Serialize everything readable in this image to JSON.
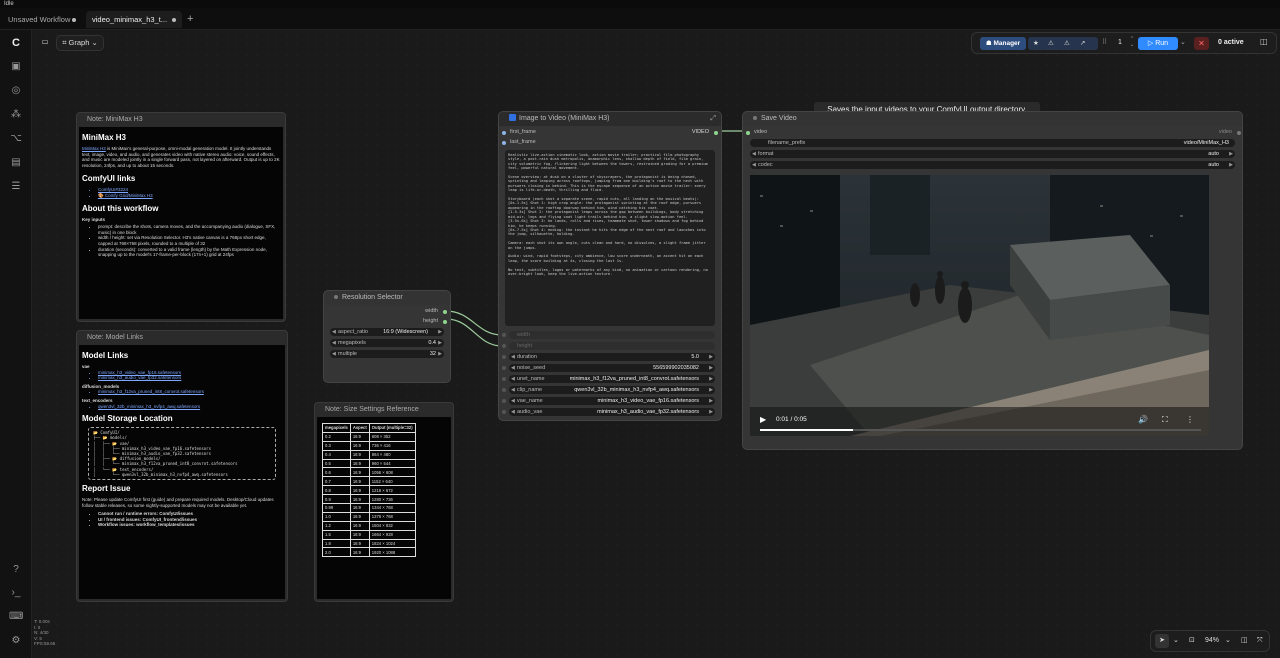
{
  "app": {
    "status": "Idle"
  },
  "tabs": [
    {
      "label": "Unsaved Workflow"
    },
    {
      "label": "video_minimax_h3_t..."
    }
  ],
  "tab_add": "+",
  "toolbar": {
    "graph_label": "Graph",
    "manager": "Manager",
    "run": "Run",
    "queue_count": "1",
    "active": "0 active"
  },
  "tooltip": "Saves the input videos to your ComfyUI output directory.",
  "stats": [
    "T: 0.00s",
    "I: 0",
    "N: 4/30",
    "V: 5",
    "FPS:59.65"
  ],
  "zoom": "94%",
  "note1": {
    "title": "Note: MiniMax H3",
    "heading": "MiniMax H3",
    "intro_link": "MiniMax H3",
    "intro": " is MiniMax's general-purpose, omni-modal generation model. It jointly understands text, image, video, and audio, and generates video with native stereo audio: voice, sound effects, and music are modeled jointly in a single forward pass, not layered on afterward. Output is up to 2K resolution, 24fps, and up to about 15 seconds.",
    "links_heading": "ComfyUI links",
    "links": [
      "ComfyUI#3224",
      "🎨 Comfy Grid/MiniMax H3"
    ],
    "about_heading": "About this workflow",
    "key_inputs": "Key inputs",
    "bullets": [
      "prompt: describe the shots, camera moves, and the accompanying audio (dialogue, SFX, music) in one block",
      "width / height: set via Resolution Selector. H3's native canvas is a 768px short edge, capped at 768×768 pixels, rounded to a multiple of 32",
      "duration (seconds): converted to a valid frame (length) by the Math Expression node, snapping up to the model's 17-frame-per-block (17n+1) grid at 24fps"
    ]
  },
  "note2": {
    "title": "Note: Model Links",
    "heading": "Model Links",
    "vae_label": "vae",
    "vae": [
      "minimax_h3_video_vae_fp16.safetensors",
      "minimax_h3_audio_vae_fp32.safetensors"
    ],
    "dm_label": "diffusion_models",
    "dm": [
      "minimax_h3_f12va_pruned_int8_convrot.safetensors"
    ],
    "te_label": "text_encoders",
    "te": [
      "qwen3vl_32b_minimax_h3_nvfp4_awq.safetensors"
    ],
    "storage_heading": "Model Storage Location",
    "tree": [
      "📂 ComfyUI/",
      "├── 📂 models/",
      "│   ├── 📂 vae/",
      "│   │   ├── minimax_h3_video_vae_fp16.safetensors",
      "│   │   └── minimax_h3_audio_vae_fp32.safetensors",
      "│   ├── 📂 diffusion_models/",
      "│   │   └── minimax_h3_f12va_pruned_int8_convrot.safetensors",
      "│   └── 📂 text_encoders/",
      "│       └── qwen3vl_32b_minimax_h3_nvfp4_awq.safetensors"
    ],
    "report_heading": "Report Issue",
    "report_text": "Note: Please update ComfyUI first (guide) and prepare required models. Desktop/Cloud updates follow stable releases, so some nightly-supported models may not be available yet.",
    "report_items": [
      "Cannot run / runtime errors: ComfyUI/issues",
      "UI / frontend issues: ComfyUI_frontend/issues",
      "Workflow issues: workflow_templates/issues"
    ]
  },
  "res": {
    "title": "Resolution Selector",
    "out_width": "width",
    "out_height": "height",
    "widgets": [
      {
        "l": "aspect_ratio",
        "v": "16:9 (Widescreen)"
      },
      {
        "l": "megapixels",
        "v": "0.4"
      },
      {
        "l": "multiple",
        "v": "32"
      }
    ]
  },
  "sizes": {
    "title": "Note: Size Settings Reference",
    "headers": [
      "megapixels",
      "Aspect",
      "Output (multiple=32)"
    ],
    "rows": [
      [
        "0.2",
        "16:9",
        "608 × 352"
      ],
      [
        "0.3",
        "16:9",
        "736 × 416"
      ],
      [
        "0.4",
        "16:9",
        "864 × 480"
      ],
      [
        "0.5",
        "16:9",
        "960 × 544"
      ],
      [
        "0.6",
        "16:9",
        "1056 × 608"
      ],
      [
        "0.7",
        "16:9",
        "1152 × 640"
      ],
      [
        "0.8",
        "16:9",
        "1216 × 672"
      ],
      [
        "0.9",
        "16:9",
        "1280 × 736"
      ],
      [
        "0.99",
        "16:9",
        "1344 × 768"
      ],
      [
        "1.0",
        "16:9",
        "1376 × 768"
      ],
      [
        "1.2",
        "16:9",
        "1504 × 832"
      ],
      [
        "1.5",
        "16:9",
        "1664 × 928"
      ],
      [
        "1.8",
        "16:9",
        "1824 × 1024"
      ],
      [
        "2.0",
        "16:9",
        "1920 × 1088"
      ]
    ]
  },
  "i2v": {
    "title": "Image to Video (MiniMax H3)",
    "in_first": "first_frame",
    "in_last": "last_frame",
    "out_video": "VIDEO",
    "prompt": "Realistic live-action cinematic look, action movie trailer; practical film photography style, a post-rain dusk metropolis, anamorphic lens, shallow depth of field, film grain, city volumetric fog, flickering light between the towers, restrained grading for a premium feel, powerful natural movement.\n\nScene overview: at dusk on a cluster of skyscrapers, the protagonist is being chased, sprinting and leaping across rooftops, jumping from one building's roof to the next with pursuers closing in behind. This is the escape sequence of an action movie trailer: every leap is life-or-death, thrilling and fluid.\n\nStoryboard (each shot a separate scene, rapid cuts, all landing on the musical beats):\n[0s-1.5s] Shot 1: high crop angle: the protagonist sprinting at the roof edge, pursuers appearing in the rooftop doorway behind him, wind catching his coat.\n[1.5-3s] Shot 2: the protagonist leaps across the gap between buildings, body stretching mid-air, legs and flying coat light trails behind him, a slight slow-motion feel.\n[3.5s-6s] Shot 3: he lands, rolls and rises, teammate shot, tower shadows and fog behind him, he keeps running.\n[6s-7.5s] Shot 4: ending: the instant he hits the edge of the next roof and launches into the jump, silhouette, holding.\n\nCamera: each shot its own angle, cuts clean and hard, no dissolves, a slight frame jitter on the jumps.\n\nAudio: wind, rapid footsteps, city ambience, low score underneath, an accent hit on each leap, the score building at 4s, closing the last 1s.\n\nNo text, subtitles, logos or watermarks of any kind, no animation or cartoon rendering, no over-bright look, keep the live-action texture.",
    "ghost": [
      "width",
      "height"
    ],
    "widgets": [
      {
        "l": "duration",
        "v": "5.0"
      },
      {
        "l": "noise_seed",
        "v": "556599902035082"
      },
      {
        "l": "unet_name",
        "v": "minimax_h3_f12va_pruned_int8_convrot.safetensors"
      },
      {
        "l": "clip_name",
        "v": "qwen3vl_32b_minimax_h3_nvfp4_awq.safetensors"
      },
      {
        "l": "vae_name",
        "v": "minimax_h3_video_vae_fp16.safetensors"
      },
      {
        "l": "audio_vae",
        "v": "minimax_h3_audio_vae_fp32.safetensors"
      }
    ]
  },
  "save": {
    "title": "Save Video",
    "in_video": "video",
    "in_right": "video",
    "widgets": [
      {
        "l": "filename_prefix",
        "v": "video/MiniMax_H3"
      },
      {
        "l": "format",
        "v": "auto"
      },
      {
        "l": "codec",
        "v": "auto"
      }
    ],
    "time": "0:01 / 0:05",
    "progress": 0.21
  }
}
